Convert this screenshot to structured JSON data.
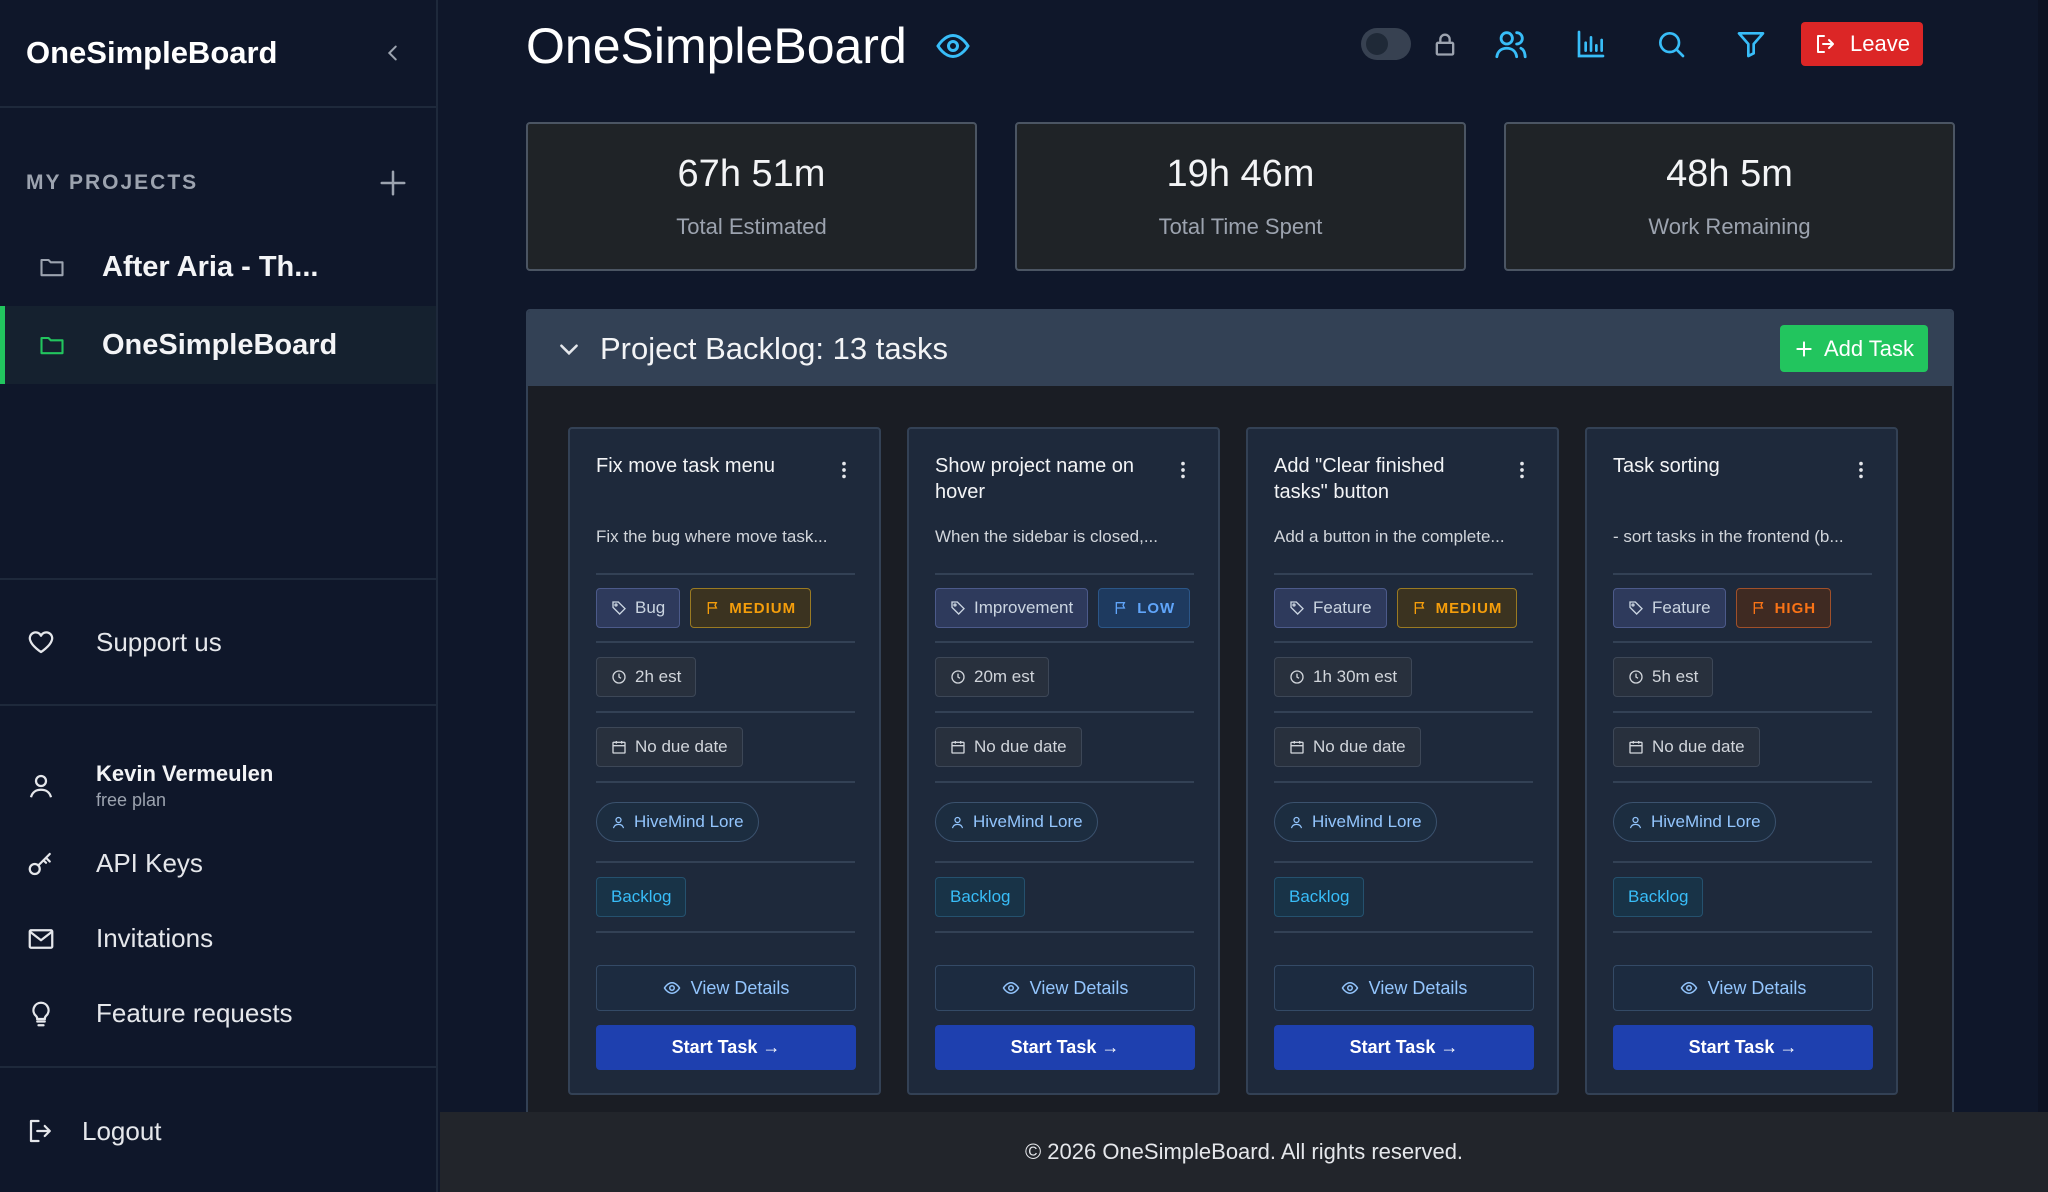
{
  "sidebar": {
    "brand": "OneSimpleBoard",
    "projects_title": "MY PROJECTS",
    "projects": [
      {
        "label": "After Aria - Th..."
      },
      {
        "label": "OneSimpleBoard"
      }
    ],
    "support_label": "Support us",
    "user": {
      "name": "Kevin Vermeulen",
      "plan": "free plan"
    },
    "links": [
      {
        "label": "API Keys"
      },
      {
        "label": "Invitations"
      },
      {
        "label": "Feature requests"
      }
    ],
    "logout_label": "Logout"
  },
  "header": {
    "title": "OneSimpleBoard",
    "leave_label": "Leave"
  },
  "stats": [
    {
      "value": "67h 51m",
      "label": "Total Estimated"
    },
    {
      "value": "19h 46m",
      "label": "Total Time Spent"
    },
    {
      "value": "48h 5m",
      "label": "Work Remaining"
    }
  ],
  "backlog": {
    "title": "Project Backlog: 13 tasks",
    "add_label": "Add Task",
    "view_label": "View Details",
    "start_label": "Start Task →",
    "cards": [
      {
        "title": "Fix move task menu",
        "desc": "Fix the bug where move task...",
        "tag": "Bug",
        "priority": "MEDIUM",
        "estimate": "2h est",
        "due": "No due date",
        "assignee": "HiveMind Lore",
        "status": "Backlog"
      },
      {
        "title": "Show project name on hover",
        "desc": "When the sidebar is closed,...",
        "tag": "Improvement",
        "priority": "LOW",
        "estimate": "20m est",
        "due": "No due date",
        "assignee": "HiveMind Lore",
        "status": "Backlog"
      },
      {
        "title": "Add \"Clear finished tasks\" button",
        "desc": "Add a button in the complete...",
        "tag": "Feature",
        "priority": "MEDIUM",
        "estimate": "1h 30m est",
        "due": "No due date",
        "assignee": "HiveMind Lore",
        "status": "Backlog"
      },
      {
        "title": "Task sorting",
        "desc": "- sort tasks in the frontend (b...",
        "tag": "Feature",
        "priority": "HIGH",
        "estimate": "5h est",
        "due": "No due date",
        "assignee": "HiveMind Lore",
        "status": "Backlog"
      }
    ]
  },
  "footer": {
    "text": "© 2026 OneSimpleBoard. All rights reserved."
  },
  "colors": {
    "accent": "#38bdf8",
    "success": "#22c55e",
    "danger": "#dc2626",
    "primary": "#1e40af"
  },
  "icons": [
    "chevron-left-icon",
    "plus-icon",
    "folder-icon",
    "heart-icon",
    "user-icon",
    "key-icon",
    "mail-icon",
    "lightbulb-icon",
    "logout-icon",
    "eye-icon",
    "lock-icon",
    "users-icon",
    "bar-chart-icon",
    "search-icon",
    "filter-icon",
    "chevron-down-icon",
    "kebab-icon",
    "tag-icon",
    "flag-icon",
    "clock-icon",
    "calendar-icon"
  ]
}
